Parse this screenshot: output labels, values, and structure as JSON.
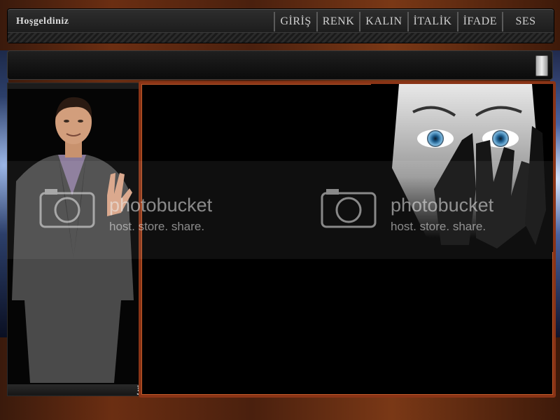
{
  "header": {
    "welcome": "Hoşgeldiniz",
    "menu": [
      {
        "id": "giris",
        "label": "GİRİŞ"
      },
      {
        "id": "renk",
        "label": "RENK"
      },
      {
        "id": "kalin",
        "label": "KALIN"
      },
      {
        "id": "italik",
        "label": "İTALİK"
      },
      {
        "id": "ifade",
        "label": "İFADE"
      },
      {
        "id": "ses",
        "label": "SES"
      }
    ]
  },
  "watermark": {
    "brand": "photobucket",
    "tagline": "host. store. share."
  },
  "colors": {
    "frame_border": "#8a3416",
    "background_wood": "#6b2e12",
    "panel": "#000000"
  },
  "icons": {
    "corner_logo": "z-logo-icon"
  }
}
